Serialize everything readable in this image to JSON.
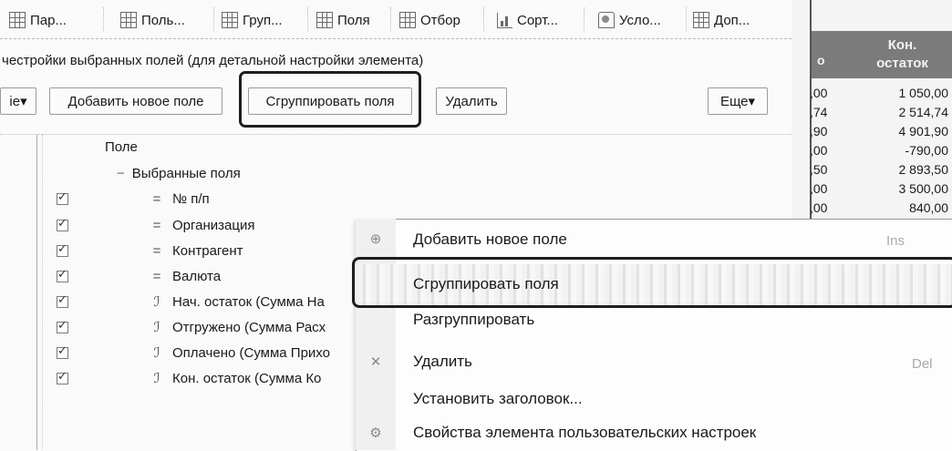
{
  "tabs": [
    {
      "label": "Пар...",
      "icon": "parameters-icon"
    },
    {
      "label": "Поль...",
      "icon": "user-fields-icon"
    },
    {
      "label": "Груп...",
      "icon": "grouping-icon"
    },
    {
      "label": "Поля",
      "icon": "fields-icon"
    },
    {
      "label": "Отбор",
      "icon": "filter-icon"
    },
    {
      "label": "Сорт...",
      "icon": "sort-icon"
    },
    {
      "label": "Усло...",
      "icon": "conditional-format-icon"
    },
    {
      "label": "Доп...",
      "icon": "additional-icon"
    }
  ],
  "description": "честройки выбранных полей (для детальной настройки элемента)",
  "toolbar": {
    "left_dropdown": "ie▾",
    "add_field": "Добавить новое поле",
    "group_fields": "Сгруппировать поля",
    "delete": "Удалить",
    "more": "Еще▾"
  },
  "tree": {
    "column_header": "Поле",
    "group_label": "Выбранные поля",
    "group_expander": "−",
    "items": [
      {
        "label": "№ п/п",
        "icon": "equals-icon",
        "glyph": "="
      },
      {
        "label": "Организация",
        "icon": "equals-icon",
        "glyph": "="
      },
      {
        "label": "Контрагент",
        "icon": "equals-icon",
        "glyph": "="
      },
      {
        "label": "Валюта",
        "icon": "equals-icon",
        "glyph": "="
      },
      {
        "label": "Нач. остаток (Сумма На",
        "icon": "resource-icon",
        "glyph": "ℐ"
      },
      {
        "label": "Отгружено (Сумма Расх",
        "icon": "resource-icon",
        "glyph": "ℐ"
      },
      {
        "label": "Оплачено (Сумма Прихо",
        "icon": "resource-icon",
        "glyph": "ℐ"
      },
      {
        "label": "Кон. остаток (Сумма Ко",
        "icon": "resource-icon",
        "glyph": "ℐ"
      }
    ]
  },
  "report": {
    "header_left": "о",
    "header_title_line1": "Кон.",
    "header_title_line2": "остаток",
    "left_col": ",00\n,74\n,90\n,00\n,50\n,00\n,00",
    "right_col": [
      "1 050,00",
      "2 514,74",
      "4 901,90",
      "-790,00",
      "2 893,50",
      "3 500,00",
      "840,00"
    ],
    "left_values": [
      ",00",
      ",74",
      ",90",
      ",00",
      ",50",
      ",00",
      ",00"
    ]
  },
  "context_menu": {
    "items": [
      {
        "label": "Добавить новое поле",
        "shortcut": "Ins",
        "icon": "add-field-icon"
      },
      {
        "label": "Сгруппировать поля",
        "shortcut": "",
        "icon": ""
      },
      {
        "label": "Разгруппировать",
        "shortcut": "",
        "icon": ""
      },
      {
        "label": "Удалить",
        "shortcut": "Del",
        "icon": "delete-icon"
      },
      {
        "label": "Установить заголовок...",
        "shortcut": "",
        "icon": ""
      },
      {
        "label": "Свойства элемента пользовательских настроек",
        "shortcut": "",
        "icon": "properties-icon"
      }
    ]
  },
  "colors": {
    "highlight_border": "#1e1e1e",
    "report_header_bg": "#7b7b7b"
  }
}
